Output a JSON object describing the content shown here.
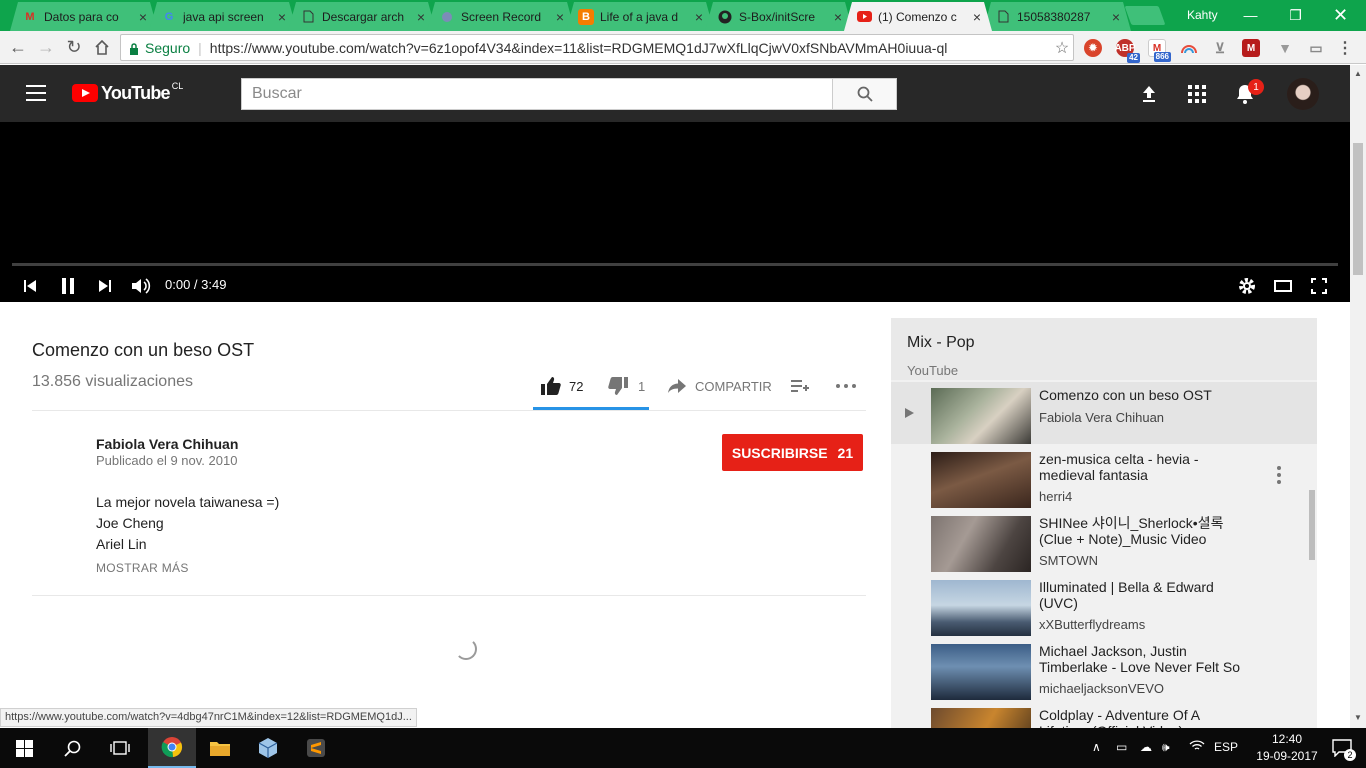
{
  "browser": {
    "tabs": [
      {
        "title": "Datos para co",
        "icon": "gmail-icon"
      },
      {
        "title": "java api screen",
        "icon": "google-icon"
      },
      {
        "title": "Descargar arch",
        "icon": "document-icon"
      },
      {
        "title": "Screen Record",
        "icon": "screen-record-icon"
      },
      {
        "title": "Life of a java d",
        "icon": "blogger-icon"
      },
      {
        "title": "S-Box/initScre",
        "icon": "github-icon"
      },
      {
        "title": "(1) Comenzo c",
        "icon": "youtube-icon",
        "active": true
      },
      {
        "title": "15058380287",
        "icon": "document-icon"
      }
    ],
    "profile_name": "Kahty",
    "secure_label": "Seguro",
    "url": "https://www.youtube.com/watch?v=6z1opof4V34&index=11&list=RDGMEMQ1dJ7wXfLlqCjwV0xfSNbAVMmAH0iuua-ql",
    "extension_badges": {
      "abp": "42",
      "gmail": "866"
    },
    "status_url": "https://www.youtube.com/watch?v=4dbg47nrC1M&index=12&list=RDGMEMQ1dJ..."
  },
  "masthead": {
    "logo_text": "YouTube",
    "country": "CL",
    "search_placeholder": "Buscar",
    "notification_count": "1"
  },
  "player": {
    "time": "0:00 / 3:49",
    "state": "playing"
  },
  "video": {
    "title": "Comenzo con un beso OST",
    "views": "13.856 visualizaciones",
    "likes": "72",
    "dislikes": "1",
    "share_label": "COMPARTIR",
    "channel": "Fabiola Vera Chihuan",
    "published": "Publicado el 9 nov. 2010",
    "subscribe_label": "SUSCRIBIRSE",
    "subscriber_count": "21",
    "description": [
      "La mejor novela taiwanesa =)",
      "Joe Cheng",
      "Ariel Lin"
    ],
    "show_more": "MOSTRAR MÁS"
  },
  "playlist": {
    "title": "Mix - Pop",
    "subtitle": "YouTube",
    "items": [
      {
        "title": "Comenzo con un beso OST",
        "channel": "Fabiola Vera Chihuan",
        "playing": true
      },
      {
        "title": "zen-musica celta - hevia - medieval fantasia",
        "channel": "herri4"
      },
      {
        "title": "SHINee 샤이니_Sherlock•셜록 (Clue + Note)_Music Video",
        "channel": "SMTOWN"
      },
      {
        "title": "Illuminated | Bella & Edward (UVC)",
        "channel": "xXButterflydreams"
      },
      {
        "title": "Michael Jackson, Justin Timberlake - Love Never Felt So",
        "channel": "michaeljacksonVEVO"
      },
      {
        "title": "Coldplay - Adventure Of A Lifetime (Official Video)",
        "channel": ""
      }
    ]
  },
  "taskbar": {
    "language": "ESP",
    "time": "12:40",
    "date": "19-09-2017",
    "notifications": "2"
  },
  "colors": {
    "tab_strip": "#0ea44c",
    "youtube_red": "#e62117",
    "masthead": "#282828",
    "like_blue": "#2793e6"
  }
}
